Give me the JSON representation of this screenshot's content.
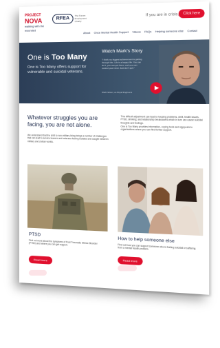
{
  "header": {
    "logo_project": "PROJECT",
    "logo_nova": "NOVA",
    "logo_walking": "walking with the wounded",
    "logo_rfea": "RFEA",
    "logo_rfea_tagline": "The Forces Employment Charity",
    "urgent_text": "If you are in crisis, please",
    "urgent_button": "Click here"
  },
  "nav": {
    "items": [
      "About",
      "Once Mental Health Support",
      "Videos",
      "FAQs",
      "Helping someone else",
      "Contact"
    ]
  },
  "hero": {
    "title_prefix": "One is ",
    "title_bold": "Too Many",
    "text": "One is Too Many offers support for vulnerable and suicidal veterans.",
    "watch_title": "Watch Mark's Story",
    "quote": "\"I think my biggest achievement is getting through this. Life is a happy life. You can do it, you can get there, and you can control your mind. Just don't quit.\"",
    "quote_by": "Mark Nelson, ex-Royal Engineers"
  },
  "intro": {
    "heading": "Whatever struggles you are facing, you are not alone.",
    "paragraph": "We understand that the shift to non-military living brings a number of challenges that can lead to service leavers and veterans feeling isolated and caught between military and civilian worlds.",
    "right_p1": "This difficult adjustment can lead to housing problems, debt, health issues, PTSD, drinking, and relationship breakdowns which in turn can cause suicidal thoughts and feelings.",
    "right_p2": "One is Too Many provides information, coping tools and signposts to organisations where you can find further support."
  },
  "cards": [
    {
      "title": "PTSD",
      "text": "Find out more about the symptoms of Post Traumatic Stress Disorder (PTSD) and where you can get support.",
      "button": "Read more"
    },
    {
      "title": "How to help someone else",
      "text": "Find out how you can support someone who is feeling suicidal or suffering from a mental health problem.",
      "button": "Read more"
    }
  ],
  "colors": {
    "brand_red": "#e0102e",
    "navy": "#1d2a4b",
    "hero_bg": "#2c3e57"
  }
}
